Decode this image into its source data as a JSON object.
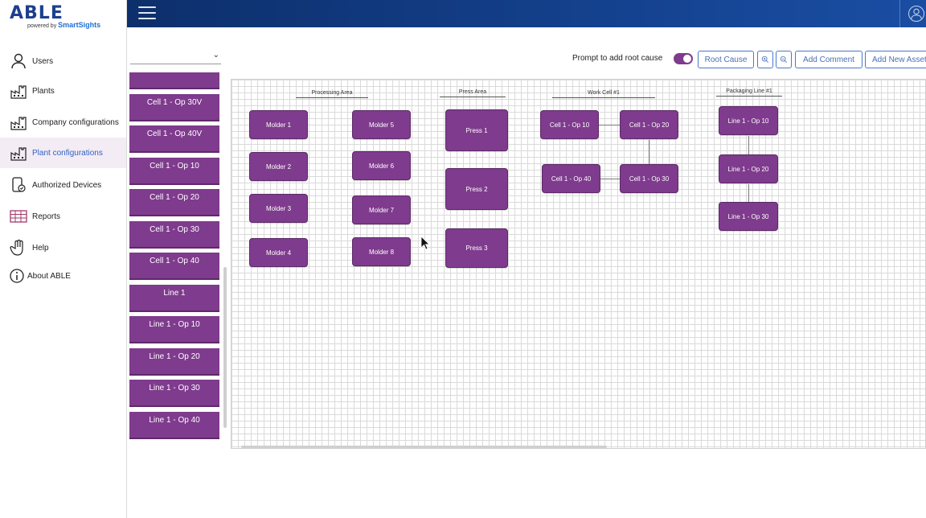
{
  "logo": {
    "title": "ABLE",
    "powered_by": "powered by",
    "brand": "SmartSights"
  },
  "sidebar": {
    "items": [
      {
        "label": "Users",
        "icon": "user-icon"
      },
      {
        "label": "Plants",
        "icon": "factory-icon"
      },
      {
        "label": "Company configurations",
        "icon": "factory-icon"
      },
      {
        "label": "Plant configurations",
        "icon": "factory-icon",
        "active": true
      },
      {
        "label": "Authorized Devices",
        "icon": "device-icon"
      },
      {
        "label": "Reports",
        "icon": "table-icon"
      },
      {
        "label": "Help",
        "icon": "hand-icon"
      },
      {
        "label": "About ABLE",
        "icon": "info-icon"
      }
    ]
  },
  "asset_panel": {
    "dropdown_value": "",
    "items": [
      "",
      "Cell 1 - Op 30V",
      "Cell 1 - Op 40V",
      "Cell 1 - Op 10",
      "Cell 1 - Op 20",
      "Cell 1 - Op 30",
      "Cell 1 - Op 40",
      "Line 1",
      "Line 1 - Op 10",
      "Line 1 - Op 20",
      "Line 1 - Op 30",
      "Line 1 - Op 40"
    ]
  },
  "toolbar": {
    "prompt_label": "Prompt to add root cause",
    "prompt_enabled": true,
    "root_cause": "Root Cause",
    "zoom_in_icon": "zoom-in-icon",
    "zoom_out_icon": "zoom-out-icon",
    "add_comment": "Add Comment",
    "add_new_asset": "Add New Asset"
  },
  "canvas": {
    "areas": {
      "processing": "Processing  Area",
      "press": "Press Area",
      "work_cell": "Work Cell #1",
      "packaging": "Packaging Line #1"
    },
    "nodes": {
      "molder1": "Molder 1",
      "molder2": "Molder 2",
      "molder3": "Molder 3",
      "molder4": "Molder 4",
      "molder5": "Molder 5",
      "molder6": "Molder 6",
      "molder7": "Molder 7",
      "molder8": "Molder 8",
      "press1": "Press 1",
      "press2": "Press 2",
      "press3": "Press 3",
      "cell_op10": "Cell 1 - Op 10",
      "cell_op20": "Cell 1 - Op 20",
      "cell_op40": "Cell 1 - Op 40",
      "cell_op30": "Cell 1 - Op 30",
      "line_op10": "Line 1 - Op 10",
      "line_op20": "Line 1 - Op 20",
      "line_op30": "Line 1 - Op 30"
    }
  },
  "colors": {
    "accent": "#7f3b8d",
    "topbar": "#14418e",
    "link": "#2d62c8"
  }
}
